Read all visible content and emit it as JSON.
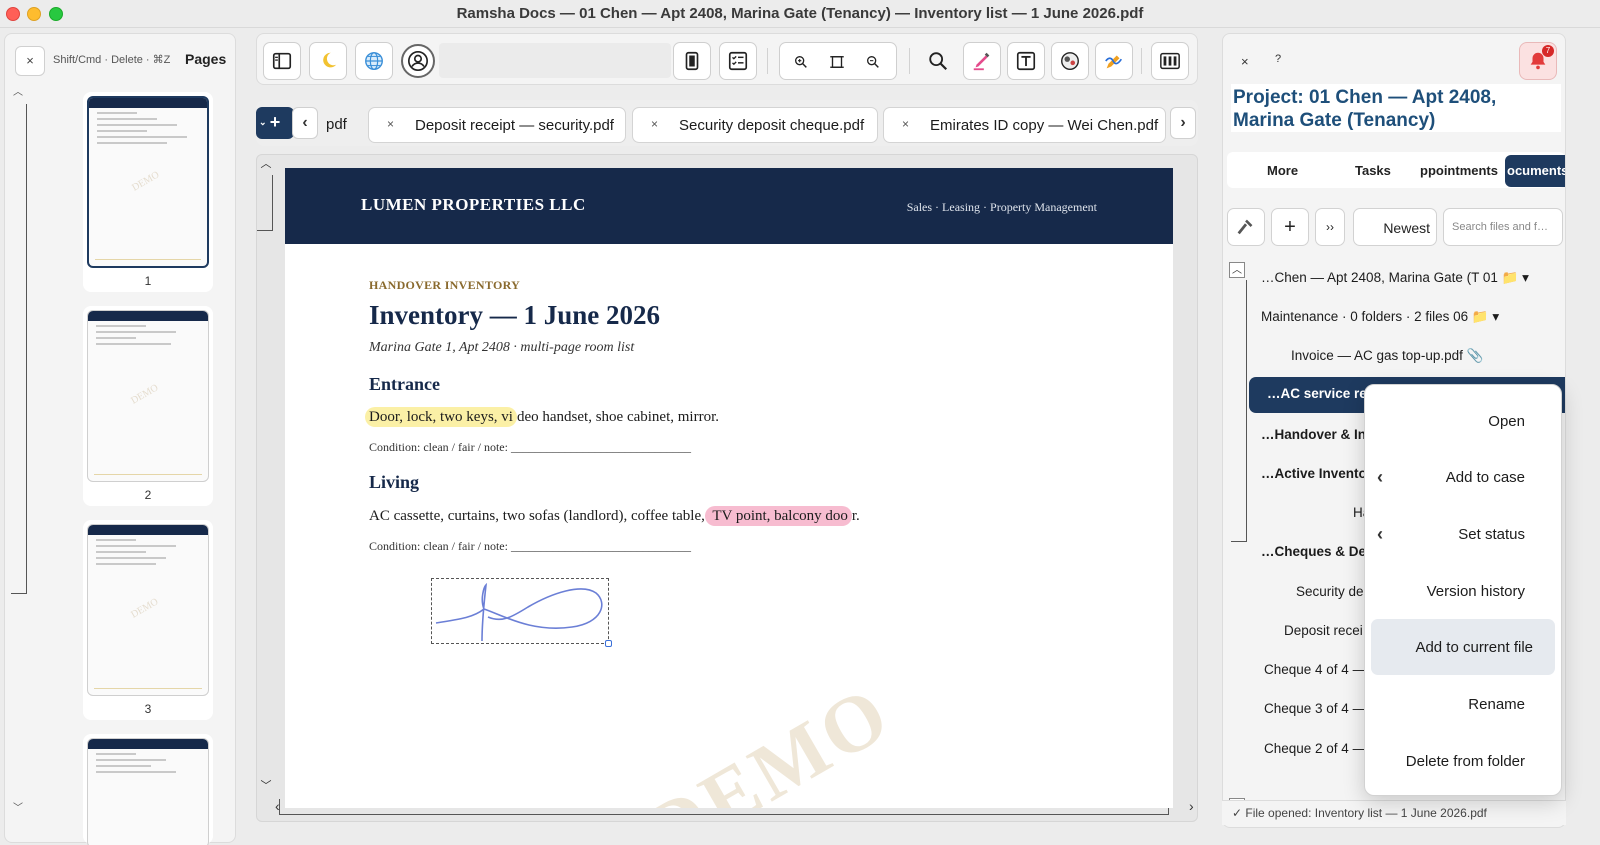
{
  "window": {
    "title": "Ramsha Docs — 01 Chen — Apt 2408, Marina Gate (Tenancy) — Inventory list — 1 June 2026.pdf"
  },
  "pages_panel": {
    "close_label": "×",
    "hint": "Shift/Cmd · Delete · ⌘Z",
    "title": "Pages",
    "thumbnails": [
      {
        "number": "1",
        "selected": true,
        "watermark": "DEMO"
      },
      {
        "number": "2",
        "selected": false,
        "watermark": "DEMO"
      },
      {
        "number": "3",
        "selected": false,
        "watermark": "DEMO"
      },
      {
        "number": "",
        "selected": false,
        "watermark": ""
      }
    ]
  },
  "toolbar": {
    "search_value": "",
    "icons": [
      "sidebar-icon",
      "moon-icon",
      "globe-icon",
      "user-circle-icon",
      "book-icon",
      "checklist-icon",
      "zoom-in-icon",
      "fit-page-icon",
      "zoom-out-icon",
      "search-icon",
      "pen-icon",
      "text-box-icon",
      "stamp-icon",
      "signature-icon",
      "columns-icon"
    ]
  },
  "tabs": {
    "new_label": "+",
    "prev_label": "‹",
    "next_label": "›",
    "items": [
      {
        "label": "pdf",
        "close": ""
      },
      {
        "label": "Deposit receipt — security.pdf",
        "close": "×"
      },
      {
        "label": "Security deposit cheque.pdf",
        "close": "×"
      },
      {
        "label": "Emirates ID copy — Wei Chen.pdf",
        "close": "×"
      }
    ]
  },
  "document": {
    "company": "LUMEN PROPERTIES LLC",
    "tagline": "Sales · Leasing · Property Management",
    "kicker": "HANDOVER INVENTORY",
    "title": "Inventory — 1 June 2026",
    "subtitle": "Marina Gate 1, Apt 2408 · multi-page room list",
    "sections": [
      {
        "heading": "Entrance",
        "highlight": "Door, lock, two keys, vi",
        "rest": "deo handset, shoe cabinet, mirror.",
        "condition": "Condition: clean / fair / note: ______________________________"
      },
      {
        "heading": "Living",
        "lead": "AC cassette, curtains, two sofas (landlord), coffee table,",
        "highlight": " TV point, balcony doo",
        "rest": "r.",
        "condition": "Condition: clean / fair / note: ______________________________"
      }
    ],
    "watermark": "DEMO",
    "colors": {
      "header_navy": "#16294a",
      "highlight_yellow": "#fbf0a6",
      "highlight_pink": "#f7bcd0",
      "signature_ink": "#6b7fd6"
    }
  },
  "right_panel": {
    "close_label": "×",
    "help_label": "?",
    "notification_count": "7",
    "project_line1": "Project: 01 Chen — Apt 2408,",
    "project_line2": "Marina Gate (Tenancy)",
    "tabs": [
      "More",
      "Tasks",
      "ppointments",
      "ocuments ·"
    ],
    "active_tab": "ocuments ·",
    "sort_label": "Newest",
    "search_placeholder": "Search files and f…",
    "tree": [
      {
        "label": "…Chen — Apt 2408, Marina Gate (T 01 📁 ▾"
      },
      {
        "label": "Maintenance  ·  0 folders · 2 files 06 📁 ▾"
      },
      {
        "label": "Invoice — AC gas top-up.pdf 📎"
      },
      {
        "label": "…AC service rec"
      },
      {
        "label": "…Handover & Inv"
      },
      {
        "label": "…Active Inventor"
      },
      {
        "label": "Ha"
      },
      {
        "label": "…Cheques & Dep"
      },
      {
        "label": "Security de"
      },
      {
        "label": "Deposit recei"
      },
      {
        "label": "Cheque 4 of 4 —"
      },
      {
        "label": "Cheque 3 of 4 —"
      },
      {
        "label": "Cheque 2 of 4 —"
      }
    ],
    "status": "✓ File opened: Inventory list — 1 June 2026.pdf"
  },
  "context_menu": {
    "items": [
      {
        "label": "Open",
        "submenu": false
      },
      {
        "label": "Add to case",
        "submenu": true
      },
      {
        "label": "Set status",
        "submenu": true
      },
      {
        "label": "Version history",
        "submenu": false
      },
      {
        "label": "Add to current file",
        "submenu": false,
        "hover": true
      },
      {
        "label": "Rename",
        "submenu": false
      },
      {
        "label": "Delete from folder",
        "submenu": false
      }
    ]
  }
}
